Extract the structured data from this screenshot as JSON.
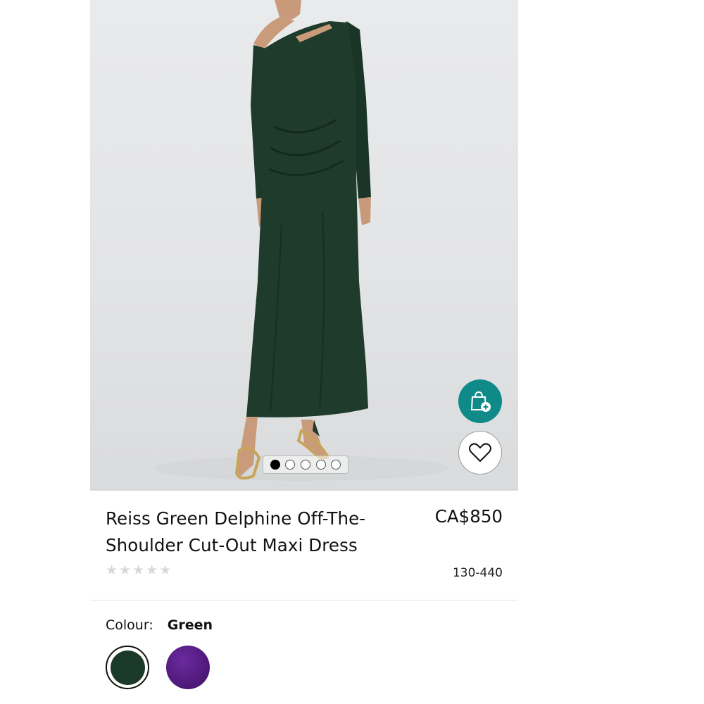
{
  "product": {
    "title": "Reiss Green Delphine Off-The-Shoulder Cut-Out Maxi Dress",
    "price": "CA$850",
    "code": "130-440",
    "rating_stars": 5
  },
  "gallery": {
    "image_count": 5,
    "active_index": 0,
    "add_to_bag_icon": "bag-plus-icon",
    "wishlist_icon": "heart-icon",
    "accent_color": "#0f8a88"
  },
  "colour": {
    "label": "Colour:",
    "selected": "Green",
    "swatches": [
      {
        "name": "Green",
        "color": "#1b3a2a"
      },
      {
        "name": "Purple",
        "color": "#4d1877"
      }
    ]
  },
  "icons": {
    "star": "★"
  }
}
